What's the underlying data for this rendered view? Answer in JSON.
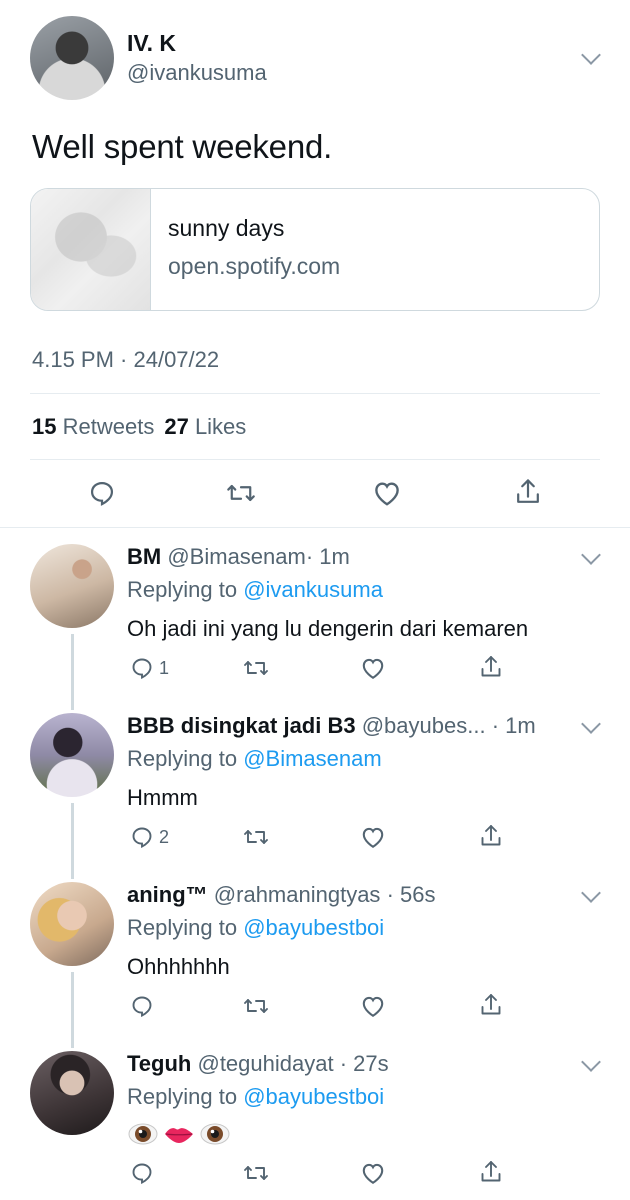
{
  "tweet": {
    "name": "IV. K",
    "handle": "@ivankusuma",
    "text": "Well spent weekend.",
    "card": {
      "title": "sunny days",
      "domain": "open.spotify.com"
    },
    "timestamp": "4.15 PM · 24/07/22",
    "retweets_count": "15",
    "retweets_label": "Retweets",
    "likes_count": "27",
    "likes_label": "Likes"
  },
  "replies": [
    {
      "name": "BM",
      "handle": "@Bimasenam",
      "time": "· 1m",
      "replying_prefix": "Replying to",
      "replying_to": "@ivankusuma",
      "text": "Oh jadi ini yang lu dengerin dari kemaren",
      "reply_count": "1"
    },
    {
      "name": "BBB disingkat jadi B3",
      "handle": "@bayubes...",
      "time": "· 1m",
      "replying_prefix": "Replying to",
      "replying_to": "@Bimasenam",
      "text": "Hmmm",
      "reply_count": "2"
    },
    {
      "name": "aning™",
      "handle": "@rahmaningtyas",
      "time": "· 56s",
      "replying_prefix": "Replying to",
      "replying_to": "@bayubestboi",
      "text": "Ohhhhhhh",
      "reply_count": ""
    },
    {
      "name": "Teguh",
      "handle": "@teguhidayat",
      "time": "· 27s",
      "replying_prefix": "Replying to",
      "replying_to": "@bayubestboi",
      "text": "",
      "emojis": [
        "eye-emoji",
        "lips-emoji",
        "eye-emoji"
      ],
      "reply_count": ""
    }
  ],
  "icons": {
    "reply": "speech-bubble-icon",
    "retweet": "retweet-icon",
    "like": "heart-icon",
    "share": "share-icon",
    "more": "chevron-down-icon"
  },
  "colors": {
    "link": "#1d9bf0",
    "secondary_text": "#536471",
    "border": "#cfd9de"
  }
}
